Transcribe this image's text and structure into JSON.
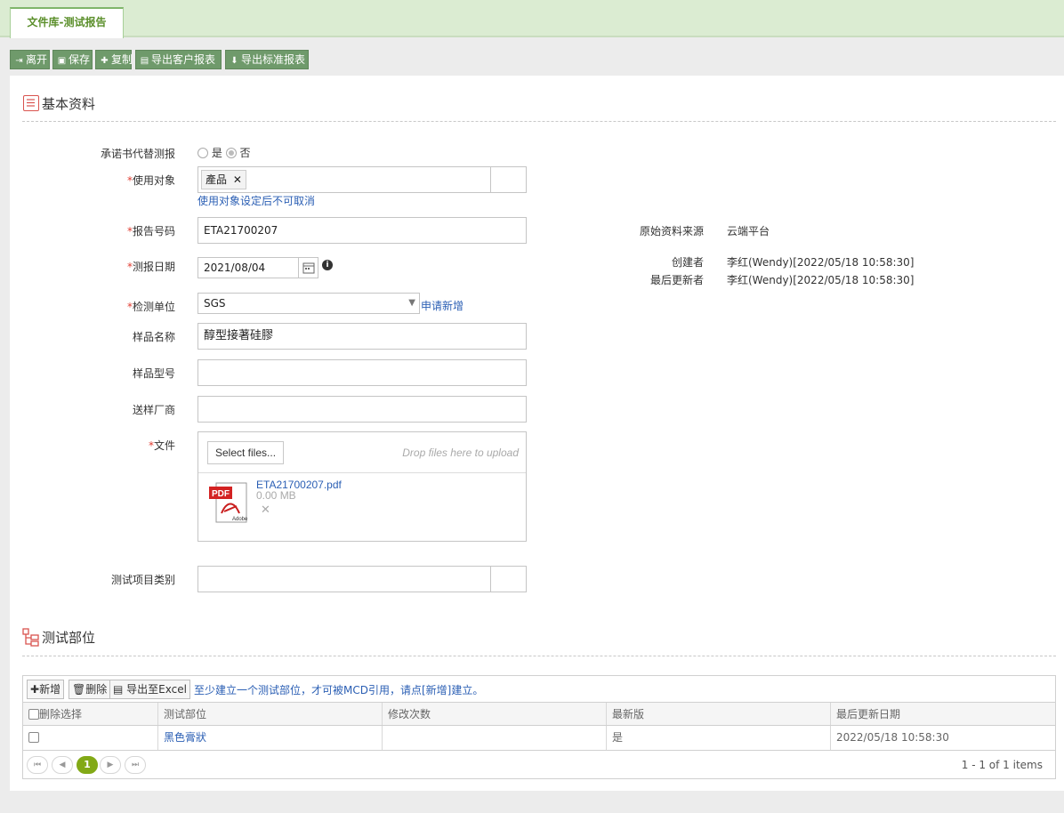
{
  "tab": {
    "title": "文件库-测试报告"
  },
  "toolbar": {
    "leave": "离开",
    "save": "保存",
    "copy": "复制",
    "export_customer": "导出客户报表",
    "export_standard": "导出标准报表"
  },
  "basic": {
    "section_title": "基本资料",
    "commitment_label": "承诺书代替测报",
    "radio_yes": "是",
    "radio_no": "否",
    "target_label": "使用对象",
    "target_tag": "產品",
    "target_hint": "使用对象设定后不可取消",
    "report_no_label": "报告号码",
    "report_no_value": "ETA21700207",
    "report_date_label": "测报日期",
    "report_date_value": "2021/08/04",
    "lab_label": "检测单位",
    "lab_value": "SGS",
    "lab_apply": "申请新增",
    "sample_name_label": "样品名称",
    "sample_name_value": "醇型接著硅膠",
    "sample_model_label": "样品型号",
    "sample_model_value": "",
    "supplier_label": "送样厂商",
    "supplier_value": "",
    "file_label": "文件",
    "select_files": "Select files...",
    "drop_hint": "Drop files here to upload",
    "file_name": "ETA21700207.pdf",
    "file_size": "0.00 MB",
    "test_category_label": "测试项目类别",
    "source_label": "原始资料来源",
    "source_value": "云端平台",
    "creator_label": "创建者",
    "creator_value": "李红(Wendy)[2022/05/18 10:58:30]",
    "updater_label": "最后更新者",
    "updater_value": "李红(Wendy)[2022/05/18 10:58:30]"
  },
  "parts": {
    "section_title": "测试部位",
    "add": "新增",
    "delete": "删除",
    "export_excel": "导出至Excel",
    "hint": "至少建立一个测试部位，才可被MCD引用，请点[新增]建立。",
    "columns": [
      "删除选择",
      "测试部位",
      "修改次数",
      "最新版",
      "最后更新日期"
    ],
    "rows": [
      {
        "part": "黑色膏狀",
        "revisions": "",
        "latest": "是",
        "updated": "2022/05/18 10:58:30"
      }
    ],
    "page": "1",
    "summary": "1 - 1 of 1 items"
  },
  "colors": {
    "accent": "#6f9a6b",
    "tab_bg": "#dbecd2",
    "link": "#2b5fb4",
    "required": "#e03c31"
  }
}
